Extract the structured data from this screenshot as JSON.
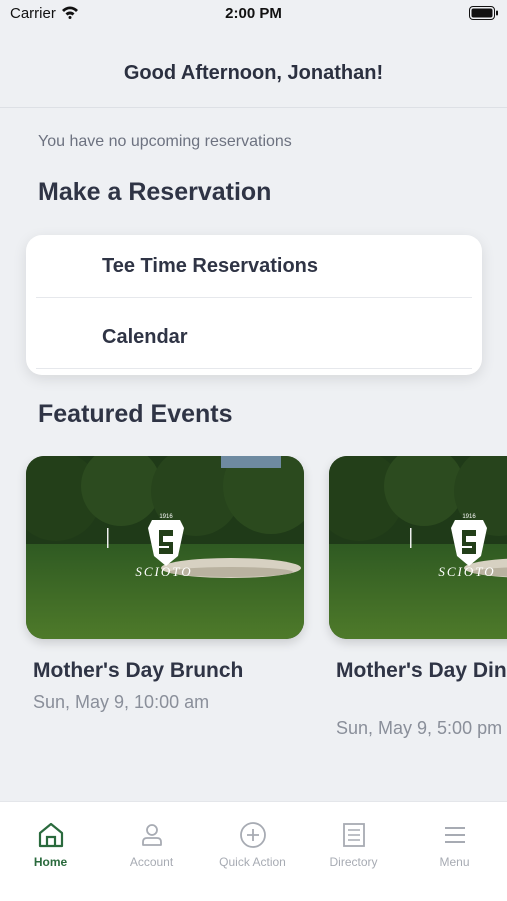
{
  "status": {
    "carrier": "Carrier",
    "time": "2:00 PM"
  },
  "header": {
    "greeting": "Good Afternoon, Jonathan!"
  },
  "reservations": {
    "empty_text": "You have no upcoming reservations"
  },
  "make_reservation": {
    "title": "Make a Reservation",
    "items": [
      {
        "label": "Tee Time Reservations"
      },
      {
        "label": "Calendar"
      }
    ]
  },
  "featured": {
    "title": "Featured Events",
    "events": [
      {
        "title": "Mother's Day Brunch",
        "date": "Sun, May 9, 10:00 am",
        "logo_text": "SCIOTO",
        "logo_year": "1916"
      },
      {
        "title": "Mother's Day Dinner Buffet",
        "date": "Sun, May 9, 5:00 pm",
        "logo_text": "SCIOTO",
        "logo_year": "1916"
      }
    ]
  },
  "tabs": [
    {
      "label": "Home",
      "icon": "home-icon",
      "active": true
    },
    {
      "label": "Account",
      "icon": "person-icon",
      "active": false
    },
    {
      "label": "Quick Action",
      "icon": "plus-circle-icon",
      "active": false
    },
    {
      "label": "Directory",
      "icon": "list-doc-icon",
      "active": false
    },
    {
      "label": "Menu",
      "icon": "hamburger-icon",
      "active": false
    }
  ],
  "colors": {
    "accent": "#2a6a3d",
    "inactive": "#a7abb3",
    "background": "#eef0f3"
  }
}
